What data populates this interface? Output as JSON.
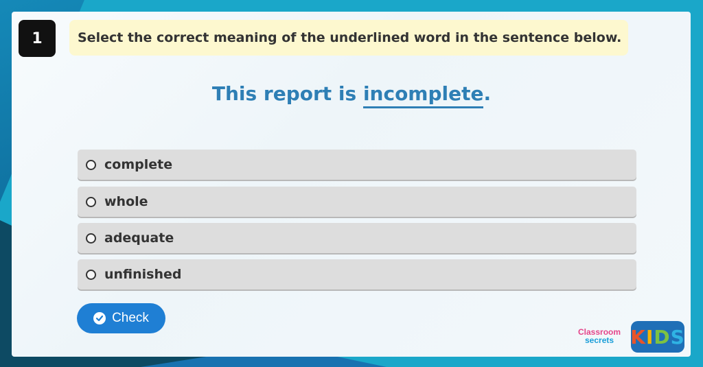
{
  "question": {
    "number": "1",
    "instruction": "Select the correct meaning of the underlined word in the sentence below.",
    "sentence_before": "This report is ",
    "underlined_word": "incomplete",
    "sentence_after": "."
  },
  "options": [
    {
      "label": "complete",
      "selected": false
    },
    {
      "label": "whole",
      "selected": false
    },
    {
      "label": "adequate",
      "selected": false
    },
    {
      "label": "unfinished",
      "selected": false
    }
  ],
  "check_button": {
    "label": "Check",
    "icon": "checkmark-circle-icon"
  },
  "branding": {
    "classroom_line1": "Classroom",
    "classroom_line2": "secrets",
    "kids_letters": [
      "K",
      "I",
      "D",
      "S"
    ],
    "kids_colors": [
      "#e8542a",
      "#f5b400",
      "#7dc242",
      "#2fb3e4"
    ]
  },
  "colors": {
    "accent_blue": "#2e7fb5",
    "button_blue": "#1f7fd4",
    "instruction_bg": "#fdf8cf",
    "option_bg": "#dddddd"
  }
}
